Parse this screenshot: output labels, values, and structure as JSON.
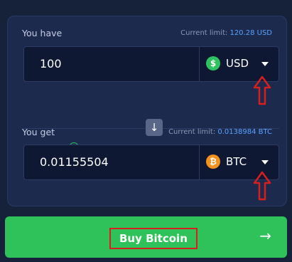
{
  "you_have": {
    "label": "You have",
    "limit_label": "Current limit:",
    "limit_value": "120.28 USD",
    "amount": "100",
    "currency": "USD",
    "currency_icon": "$"
  },
  "you_get": {
    "label": "You get",
    "info_icon": "i",
    "limit_label": "Current limit:",
    "limit_value": "0.0138984 BTC",
    "amount": "0.01155504",
    "currency": "BTC",
    "currency_icon": "₿"
  },
  "swap_icon": "↓",
  "buy_button": {
    "label": "Buy Bitcoin",
    "arrow": "→"
  },
  "colors": {
    "background": "#16213a",
    "panel": "#1c2a4d",
    "accent_green": "#2fc15a",
    "link_blue": "#5aa2ff",
    "usd_coin": "#2ec260",
    "btc_coin": "#f3921f",
    "annotation_red": "#d81f1f"
  }
}
